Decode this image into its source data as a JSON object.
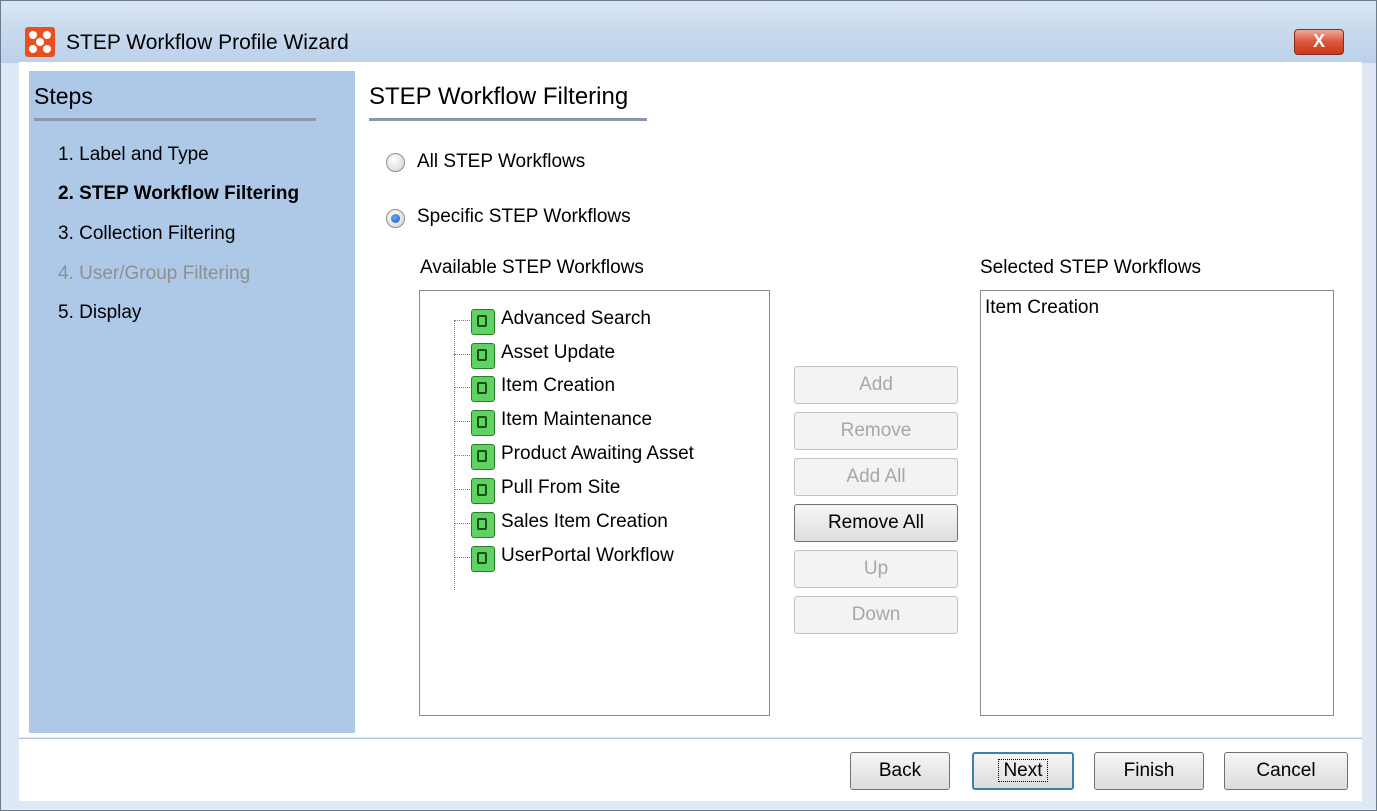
{
  "window": {
    "title": "STEP Workflow Profile Wizard",
    "close_label": "X"
  },
  "steps": {
    "title": "Steps",
    "items": [
      {
        "label": "1. Label and Type",
        "state": "normal"
      },
      {
        "label": "2. STEP Workflow Filtering",
        "state": "active"
      },
      {
        "label": "3. Collection Filtering",
        "state": "normal"
      },
      {
        "label": "4. User/Group Filtering",
        "state": "disabled"
      },
      {
        "label": "5. Display",
        "state": "normal"
      }
    ]
  },
  "main": {
    "title": "STEP Workflow Filtering",
    "radio_all": {
      "label": "All STEP Workflows",
      "checked": false
    },
    "radio_specific": {
      "label": "Specific STEP Workflows",
      "checked": true
    },
    "available": {
      "label": "Available STEP Workflows",
      "items": [
        "Advanced Search",
        "Asset Update",
        "Item Creation",
        "Item Maintenance",
        "Product Awaiting Asset",
        "Pull From Site",
        "Sales Item Creation",
        "UserPortal Workflow"
      ]
    },
    "selected": {
      "label": "Selected STEP Workflows",
      "items": [
        "Item Creation"
      ]
    },
    "buttons": {
      "add": "Add",
      "remove": "Remove",
      "add_all": "Add All",
      "remove_all": "Remove All",
      "up": "Up",
      "down": "Down"
    }
  },
  "footer": {
    "back": "Back",
    "next": "Next",
    "finish": "Finish",
    "cancel": "Cancel"
  },
  "colors": {
    "steps_panel": "#aec8e8",
    "window_frame": "#dfe9f5",
    "workflow_icon": "#5fd35f"
  }
}
